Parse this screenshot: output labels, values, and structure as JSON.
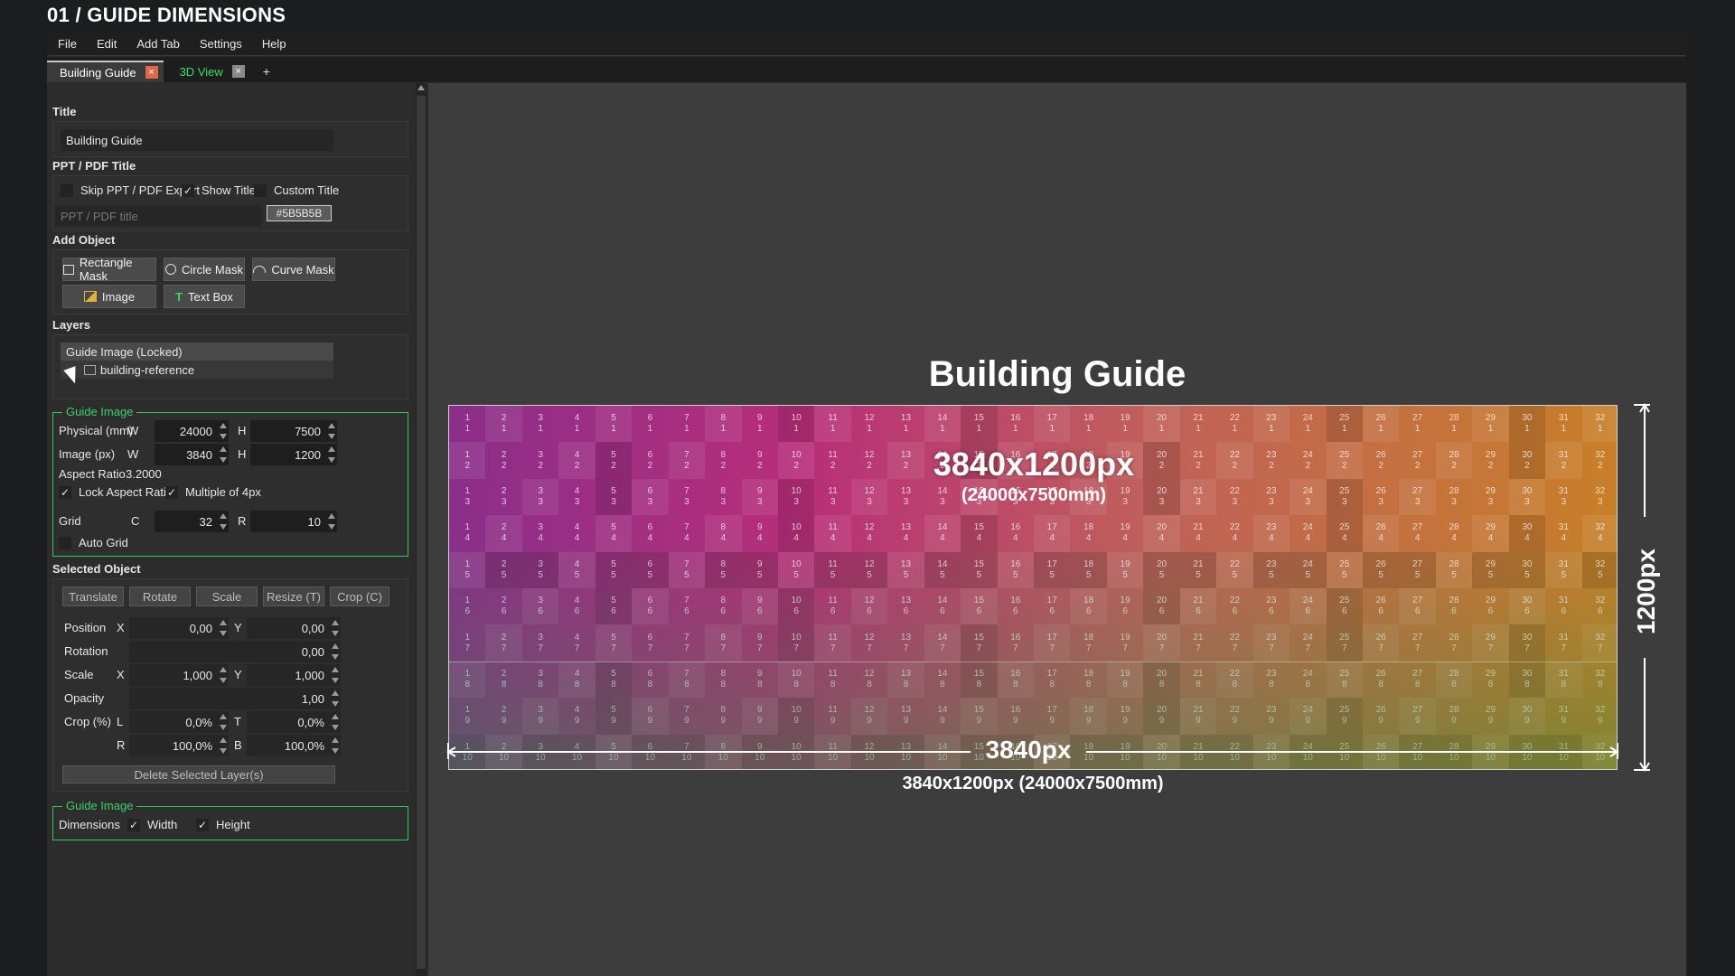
{
  "app": {
    "title": "01 / GUIDE DIMENSIONS"
  },
  "menu": [
    "File",
    "Edit",
    "Add Tab",
    "Settings",
    "Help"
  ],
  "tabs": [
    {
      "label": "Building Guide",
      "close": "×",
      "active": true
    },
    {
      "label": "3D View",
      "close": "×",
      "active": false
    }
  ],
  "tab_add": "+",
  "title_section": {
    "heading": "Title",
    "value": "Building Guide"
  },
  "ppt_section": {
    "heading": "PPT / PDF Title",
    "skip_label": "Skip PPT / PDF Export",
    "skip_checked": false,
    "show_title_label": "Show Title",
    "show_title_checked": true,
    "custom_title_label": "Custom Title",
    "custom_title_checked": false,
    "title_placeholder": "PPT / PDF title",
    "color_value": "#5B5B5B"
  },
  "add_object": {
    "heading": "Add Object",
    "rect_mask": "Rectangle Mask",
    "circle_mask": "Circle Mask",
    "curve_mask": "Curve Mask",
    "image": "Image",
    "text_box": "Text Box"
  },
  "layers": {
    "heading": "Layers",
    "items": [
      "Guide Image (Locked)",
      "building-reference"
    ]
  },
  "guide_image": {
    "heading": "Guide Image",
    "physical_label": "Physical (mm)",
    "w_label": "W",
    "h_label": "H",
    "physical_w": "24000",
    "physical_h": "7500",
    "image_label": "Image (px)",
    "image_w": "3840",
    "image_h": "1200",
    "aspect_label": "Aspect Ratio",
    "aspect_value": "3.2000",
    "lock_aspect_label": "Lock Aspect Ratio",
    "lock_aspect_checked": true,
    "multiple4_label": "Multiple of 4px",
    "multiple4_checked": true,
    "grid_label": "Grid",
    "c_label": "C",
    "r_label": "R",
    "grid_c": "32",
    "grid_r": "10",
    "auto_grid_label": "Auto Grid",
    "auto_grid_checked": false
  },
  "selected_object": {
    "heading": "Selected Object",
    "modes": [
      "Translate",
      "Rotate",
      "Scale",
      "Resize (T)",
      "Crop (C)"
    ],
    "position_label": "Position",
    "x_label": "X",
    "y_label": "Y",
    "pos_x": "0,00",
    "pos_y": "0,00",
    "rotation_label": "Rotation",
    "rotation": "0,00",
    "scale_label": "Scale",
    "scale_x": "1,000",
    "scale_y": "1,000",
    "opacity_label": "Opacity",
    "opacity": "1,00",
    "crop_label": "Crop (%)",
    "l_label": "L",
    "t_label": "T",
    "r_label": "R",
    "b_label": "B",
    "crop_l": "0,0%",
    "crop_t": "0,0%",
    "crop_r": "100,0%",
    "crop_b": "100,0%",
    "delete_label": "Delete Selected Layer(s)"
  },
  "guide_dims": {
    "heading": "Guide Image",
    "dimensions_label": "Dimensions",
    "width_label": "Width",
    "width_checked": true,
    "height_label": "Height",
    "height_checked": true
  },
  "canvas": {
    "title": "Building Guide",
    "resolution": "3840x1200px",
    "physical": "(24000x7500mm)",
    "width_dim": "3840px",
    "height_dim": "1200px",
    "summary": "3840x1200px (24000x7500mm)",
    "grid_cols": 32,
    "grid_rows": 10
  }
}
